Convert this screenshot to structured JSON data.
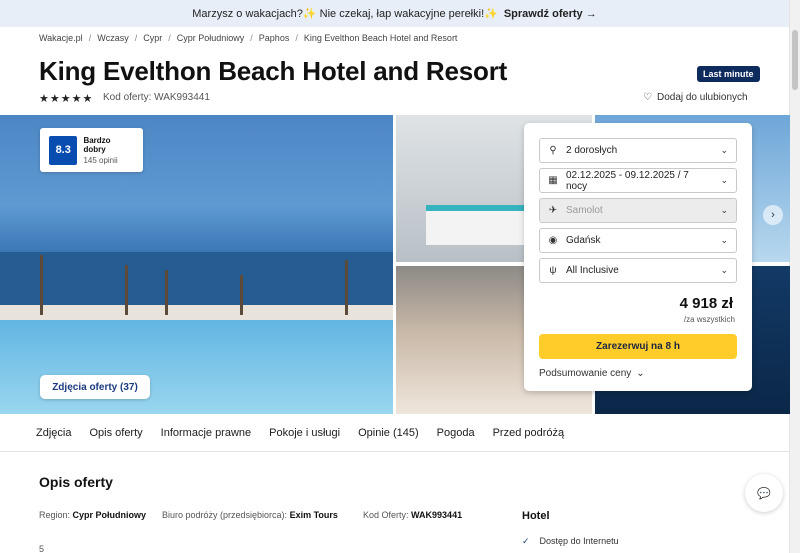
{
  "promo": {
    "text": "Marzysz o wakacjach?✨ Nie czekaj, łap wakacyjne perełki!✨",
    "link": "Sprawdź oferty →"
  },
  "breadcrumb": [
    "Wakacje.pl",
    "Wczasy",
    "Cypr",
    "Cypr Południowy",
    "Paphos",
    "King Evelthon Beach Hotel and Resort"
  ],
  "hotel": {
    "title": "King Evelthon Beach Hotel and Resort",
    "badge": "Last minute",
    "stars": "★★★★★",
    "offer_code_label": "Kod oferty: WAK993441",
    "favorite_label": "Dodaj do ulubionych"
  },
  "rating": {
    "score": "8.3",
    "label": "Bardzo dobry",
    "count": "145 opinii"
  },
  "photos_button": "Zdjęcia oferty (37)",
  "booking": {
    "guests": "2 dorosłych",
    "dates": "02.12.2025 - 09.12.2025 / 7 nocy",
    "transport": "Samolot",
    "departure": "Gdańsk",
    "board": "All Inclusive",
    "price": "4 918 zł",
    "price_note": "/za wszystkich",
    "book_label": "Zarezerwuj na 8 h",
    "summary_label": "Podsumowanie ceny"
  },
  "tabs": [
    "Zdjęcia",
    "Opis oferty",
    "Informacje prawne",
    "Pokoje i usługi",
    "Opinie (145)",
    "Pogoda",
    "Przed podróżą"
  ],
  "description": {
    "title": "Opis oferty",
    "region_label": "Region:",
    "region": "Cypr Południowy",
    "agency_label": "Biuro podróży (przedsiębiorca):",
    "agency": "Exim Tours",
    "code_label": "Kod Oferty:",
    "code": "WAK993441",
    "stars_count": "5"
  },
  "hotel_section": {
    "title": "Hotel",
    "amenity": "Dostęp do Internetu"
  },
  "colors": {
    "accent": "#0a4db1",
    "book": "#ffcc2a",
    "badge": "#0d2b5c"
  }
}
